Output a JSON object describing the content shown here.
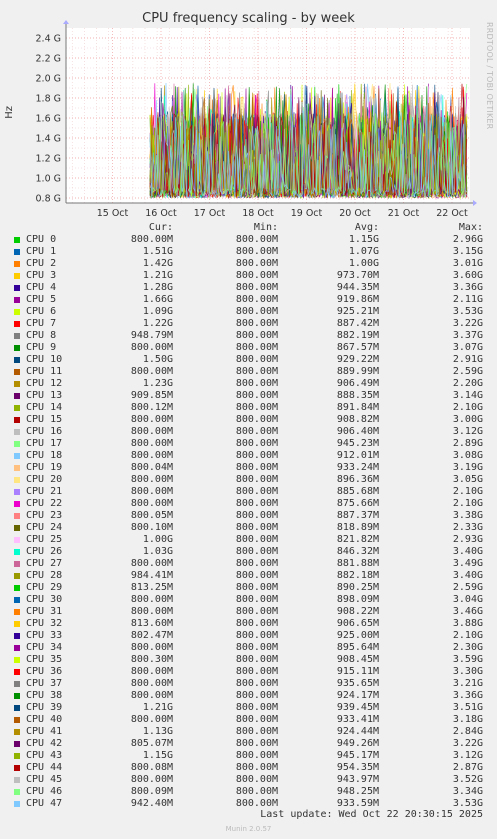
{
  "title": "CPU frequency scaling - by week",
  "side_label": "RRDTOOL / TOBI OETIKER",
  "footer": "Last update: Wed Oct 22 20:30:15 2025",
  "munin": "Munin 2.0.57",
  "legend_header": {
    "cur": "Cur:",
    "min": "Min:",
    "avg": "Avg:",
    "max": "Max:"
  },
  "chart_data": {
    "type": "line",
    "ylabel": "Hz",
    "y_ticks": [
      "0.8 G",
      "1.0 G",
      "1.2 G",
      "1.4 G",
      "1.6 G",
      "1.8 G",
      "2.0 G",
      "2.2 G",
      "2.4 G"
    ],
    "y_tick_values": [
      0.8,
      1.0,
      1.2,
      1.4,
      1.6,
      1.8,
      2.0,
      2.2,
      2.4
    ],
    "ylim": [
      0.75,
      2.5
    ],
    "x_ticks": [
      "15 Oct",
      "16 Oct",
      "17 Oct",
      "18 Oct",
      "19 Oct",
      "20 Oct",
      "21 Oct",
      "22 Oct"
    ],
    "x_range_days": [
      "Oct 15 00:00",
      "Oct 22 20:30"
    ],
    "data_start": "Oct 16 03:00",
    "grid": true,
    "series": [
      {
        "name": "CPU 0",
        "color": "#00cc00",
        "cur": "800.00M",
        "min": "800.00M",
        "avg": "1.15G",
        "max": "2.96G"
      },
      {
        "name": "CPU 1",
        "color": "#0066b3",
        "cur": "1.51G",
        "min": "800.00M",
        "avg": "1.07G",
        "max": "3.15G"
      },
      {
        "name": "CPU 2",
        "color": "#ff8000",
        "cur": "1.42G",
        "min": "800.00M",
        "avg": "1.00G",
        "max": "3.01G"
      },
      {
        "name": "CPU 3",
        "color": "#ffcc00",
        "cur": "1.21G",
        "min": "800.00M",
        "avg": "973.70M",
        "max": "3.60G"
      },
      {
        "name": "CPU 4",
        "color": "#330099",
        "cur": "1.28G",
        "min": "800.00M",
        "avg": "944.35M",
        "max": "3.36G"
      },
      {
        "name": "CPU 5",
        "color": "#990099",
        "cur": "1.66G",
        "min": "800.00M",
        "avg": "919.86M",
        "max": "2.11G"
      },
      {
        "name": "CPU 6",
        "color": "#ccff00",
        "cur": "1.09G",
        "min": "800.00M",
        "avg": "925.21M",
        "max": "3.53G"
      },
      {
        "name": "CPU 7",
        "color": "#ff0000",
        "cur": "1.22G",
        "min": "800.00M",
        "avg": "887.42M",
        "max": "3.22G"
      },
      {
        "name": "CPU 8",
        "color": "#808080",
        "cur": "948.79M",
        "min": "800.00M",
        "avg": "882.19M",
        "max": "3.37G"
      },
      {
        "name": "CPU 9",
        "color": "#008f00",
        "cur": "800.00M",
        "min": "800.00M",
        "avg": "867.57M",
        "max": "3.07G"
      },
      {
        "name": "CPU 10",
        "color": "#00487d",
        "cur": "1.50G",
        "min": "800.00M",
        "avg": "929.22M",
        "max": "2.91G"
      },
      {
        "name": "CPU 11",
        "color": "#b35a00",
        "cur": "800.00M",
        "min": "800.00M",
        "avg": "889.99M",
        "max": "2.59G"
      },
      {
        "name": "CPU 12",
        "color": "#b38f00",
        "cur": "1.23G",
        "min": "800.00M",
        "avg": "906.49M",
        "max": "2.20G"
      },
      {
        "name": "CPU 13",
        "color": "#6b006b",
        "cur": "909.85M",
        "min": "800.00M",
        "avg": "888.35M",
        "max": "3.14G"
      },
      {
        "name": "CPU 14",
        "color": "#8fb300",
        "cur": "800.12M",
        "min": "800.00M",
        "avg": "891.84M",
        "max": "2.10G"
      },
      {
        "name": "CPU 15",
        "color": "#b30000",
        "cur": "800.00M",
        "min": "800.00M",
        "avg": "908.82M",
        "max": "3.00G"
      },
      {
        "name": "CPU 16",
        "color": "#bebebe",
        "cur": "800.00M",
        "min": "800.00M",
        "avg": "906.40M",
        "max": "3.12G"
      },
      {
        "name": "CPU 17",
        "color": "#80ff80",
        "cur": "800.00M",
        "min": "800.00M",
        "avg": "945.23M",
        "max": "2.89G"
      },
      {
        "name": "CPU 18",
        "color": "#80c9ff",
        "cur": "800.00M",
        "min": "800.00M",
        "avg": "912.01M",
        "max": "3.08G"
      },
      {
        "name": "CPU 19",
        "color": "#ffc080",
        "cur": "800.04M",
        "min": "800.00M",
        "avg": "933.24M",
        "max": "3.19G"
      },
      {
        "name": "CPU 20",
        "color": "#ffe680",
        "cur": "800.00M",
        "min": "800.00M",
        "avg": "896.36M",
        "max": "3.05G"
      },
      {
        "name": "CPU 21",
        "color": "#aa80ff",
        "cur": "800.00M",
        "min": "800.00M",
        "avg": "885.68M",
        "max": "2.10G"
      },
      {
        "name": "CPU 22",
        "color": "#ee00cc",
        "cur": "800.00M",
        "min": "800.00M",
        "avg": "875.66M",
        "max": "2.10G"
      },
      {
        "name": "CPU 23",
        "color": "#ff8080",
        "cur": "800.05M",
        "min": "800.00M",
        "avg": "887.37M",
        "max": "3.38G"
      },
      {
        "name": "CPU 24",
        "color": "#666600",
        "cur": "800.10M",
        "min": "800.00M",
        "avg": "818.89M",
        "max": "2.33G"
      },
      {
        "name": "CPU 25",
        "color": "#ffbfff",
        "cur": "1.00G",
        "min": "800.00M",
        "avg": "821.82M",
        "max": "2.93G"
      },
      {
        "name": "CPU 26",
        "color": "#00ffcc",
        "cur": "1.03G",
        "min": "800.00M",
        "avg": "846.32M",
        "max": "3.40G"
      },
      {
        "name": "CPU 27",
        "color": "#cc6699",
        "cur": "800.00M",
        "min": "800.00M",
        "avg": "881.88M",
        "max": "3.49G"
      },
      {
        "name": "CPU 28",
        "color": "#999900",
        "cur": "984.41M",
        "min": "800.00M",
        "avg": "882.18M",
        "max": "3.40G"
      },
      {
        "name": "CPU 29",
        "color": "#00cc00",
        "cur": "813.25M",
        "min": "800.00M",
        "avg": "890.25M",
        "max": "2.59G"
      },
      {
        "name": "CPU 30",
        "color": "#0066b3",
        "cur": "800.00M",
        "min": "800.00M",
        "avg": "898.09M",
        "max": "3.04G"
      },
      {
        "name": "CPU 31",
        "color": "#ff8000",
        "cur": "800.00M",
        "min": "800.00M",
        "avg": "908.22M",
        "max": "3.46G"
      },
      {
        "name": "CPU 32",
        "color": "#ffcc00",
        "cur": "813.60M",
        "min": "800.00M",
        "avg": "906.65M",
        "max": "3.88G"
      },
      {
        "name": "CPU 33",
        "color": "#330099",
        "cur": "802.47M",
        "min": "800.00M",
        "avg": "925.00M",
        "max": "2.10G"
      },
      {
        "name": "CPU 34",
        "color": "#990099",
        "cur": "800.00M",
        "min": "800.00M",
        "avg": "895.64M",
        "max": "2.30G"
      },
      {
        "name": "CPU 35",
        "color": "#ccff00",
        "cur": "800.30M",
        "min": "800.00M",
        "avg": "908.45M",
        "max": "3.59G"
      },
      {
        "name": "CPU 36",
        "color": "#ff0000",
        "cur": "800.00M",
        "min": "800.00M",
        "avg": "915.11M",
        "max": "3.30G"
      },
      {
        "name": "CPU 37",
        "color": "#808080",
        "cur": "800.00M",
        "min": "800.00M",
        "avg": "935.65M",
        "max": "3.21G"
      },
      {
        "name": "CPU 38",
        "color": "#008f00",
        "cur": "800.00M",
        "min": "800.00M",
        "avg": "924.17M",
        "max": "3.36G"
      },
      {
        "name": "CPU 39",
        "color": "#00487d",
        "cur": "1.21G",
        "min": "800.00M",
        "avg": "939.45M",
        "max": "3.51G"
      },
      {
        "name": "CPU 40",
        "color": "#b35a00",
        "cur": "800.00M",
        "min": "800.00M",
        "avg": "933.41M",
        "max": "3.18G"
      },
      {
        "name": "CPU 41",
        "color": "#b38f00",
        "cur": "1.13G",
        "min": "800.00M",
        "avg": "924.44M",
        "max": "2.84G"
      },
      {
        "name": "CPU 42",
        "color": "#6b006b",
        "cur": "805.07M",
        "min": "800.00M",
        "avg": "949.26M",
        "max": "3.22G"
      },
      {
        "name": "CPU 43",
        "color": "#8fb300",
        "cur": "1.15G",
        "min": "800.00M",
        "avg": "945.17M",
        "max": "3.12G"
      },
      {
        "name": "CPU 44",
        "color": "#b30000",
        "cur": "800.08M",
        "min": "800.00M",
        "avg": "954.35M",
        "max": "2.87G"
      },
      {
        "name": "CPU 45",
        "color": "#bebebe",
        "cur": "800.00M",
        "min": "800.00M",
        "avg": "943.97M",
        "max": "3.52G"
      },
      {
        "name": "CPU 46",
        "color": "#80ff80",
        "cur": "800.09M",
        "min": "800.00M",
        "avg": "948.25M",
        "max": "3.34G"
      },
      {
        "name": "CPU 47",
        "color": "#80c9ff",
        "cur": "942.40M",
        "min": "800.00M",
        "avg": "933.59M",
        "max": "3.53G"
      }
    ]
  }
}
